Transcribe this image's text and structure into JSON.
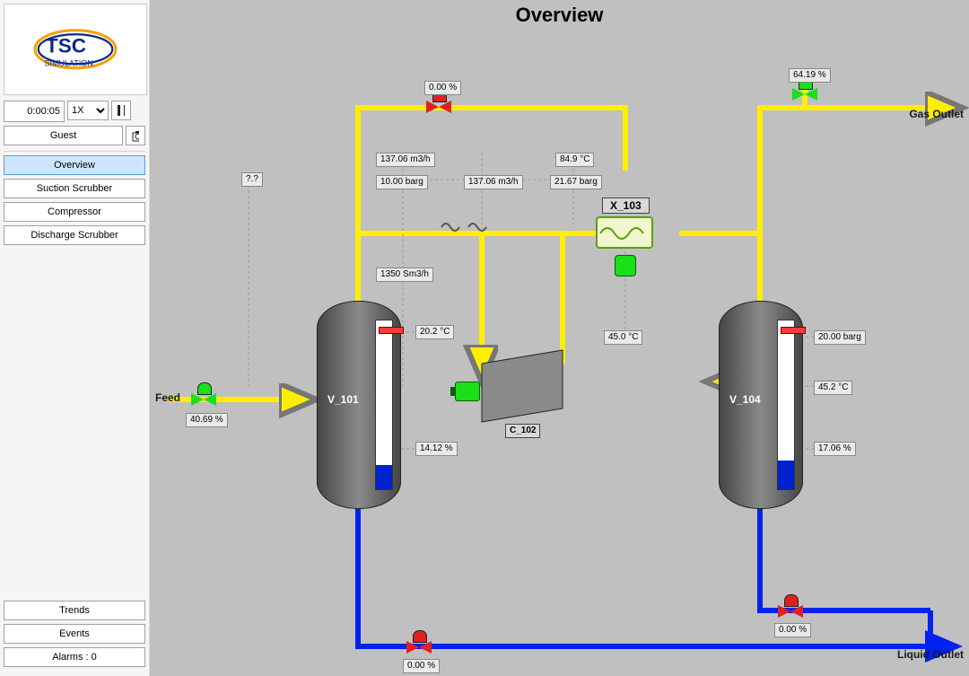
{
  "title": "Overview",
  "colors": {
    "gas": "#ffee00",
    "liquid": "#0022ee",
    "open": "#19e019",
    "closed": "#e02020"
  },
  "sidebar": {
    "logo_text": "SIMULATION",
    "time": "0:00:05",
    "speed": "1X",
    "user": "Guest",
    "nav": [
      {
        "id": "overview",
        "label": "Overview",
        "active": true
      },
      {
        "id": "suction",
        "label": "Suction Scrubber",
        "active": false
      },
      {
        "id": "compressor",
        "label": "Compressor",
        "active": false
      },
      {
        "id": "discharge",
        "label": "Discharge Scrubber",
        "active": false
      }
    ],
    "bottom": [
      {
        "id": "trends",
        "label": "Trends"
      },
      {
        "id": "events",
        "label": "Events"
      },
      {
        "id": "alarms",
        "label": "Alarms : 0"
      }
    ]
  },
  "equipment": {
    "v101": {
      "name": "V_101",
      "level_pct": 14.12,
      "temp": "20.2 °C"
    },
    "c102": {
      "name": "C_102"
    },
    "x103": {
      "name": "X_103"
    },
    "v104": {
      "name": "V_104",
      "level_pct": 17.06,
      "press": "20.00 barg",
      "temp": "45.2 °C"
    }
  },
  "valves": {
    "feed": {
      "pct": "40.69 %",
      "open": true
    },
    "recycle": {
      "pct": "0.00 %",
      "open": false
    },
    "gas_out": {
      "pct": "64.19 %",
      "open": true
    },
    "v101_drain": {
      "pct": "0.00 %",
      "open": false
    },
    "v104_drain": {
      "pct": "0.00 %",
      "open": false
    }
  },
  "readings": {
    "feed_rate": "?.?",
    "suction_flow": "137.06 m3/h",
    "suction_press": "10.00 barg",
    "std_flow": "1350 Sm3/h",
    "discharge_flow": "137.06 m3/h",
    "discharge_temp": "84.9 °C",
    "discharge_press": "21.67 barg",
    "hx_out_temp": "45.0 °C"
  },
  "labels": {
    "feed": "Feed",
    "gas_outlet": "Gas Outlet",
    "liquid_outlet": "Liquid Outlet"
  }
}
